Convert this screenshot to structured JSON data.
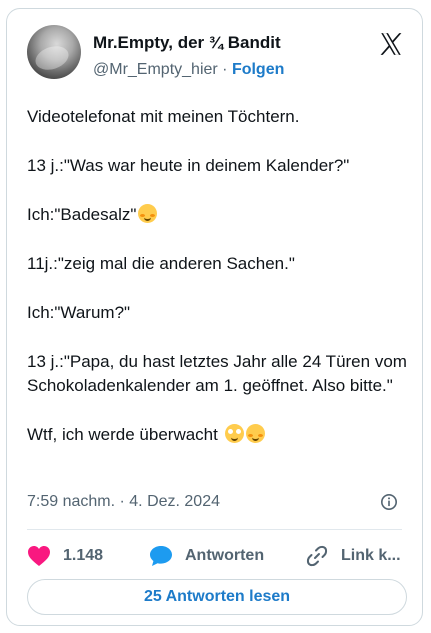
{
  "author": {
    "display_name": "Mr.Empty, der ¾ Bandit",
    "handle": "@Mr_Empty_hier",
    "separator": " · ",
    "follow_label": "Folgen"
  },
  "tweet": {
    "lines": [
      "Videotelefonat mit meinen Töchtern.",
      "13 j.:\"Was war heute in deinem Kalender?\"",
      "Ich:\"Badesalz\"",
      "11j.:\"zeig mal die anderen Sachen.\"",
      "Ich:\"Warum?\"",
      "13 j.:\"Papa, du hast letztes Jahr alle 24 Türen vom Schokoladenkalender am 1. geöffnet. Also bitte.\"",
      "Wtf, ich werde überwacht"
    ],
    "timestamp": "7:59 nachm. · 4. Dez. 2024"
  },
  "actions": {
    "like_count": "1.148",
    "reply_label": "Antworten",
    "link_label": "Link k..."
  },
  "read_replies_label": "25 Antworten lesen",
  "colors": {
    "accent": "#1d7bc9",
    "like": "#f91880",
    "reply": "#1d9bf0",
    "muted": "#536471"
  },
  "icons": [
    "x-logo-icon",
    "info-icon",
    "heart-icon",
    "reply-bubble-icon",
    "link-icon",
    "smiling-blush-emoji",
    "flushed-face-emoji"
  ]
}
